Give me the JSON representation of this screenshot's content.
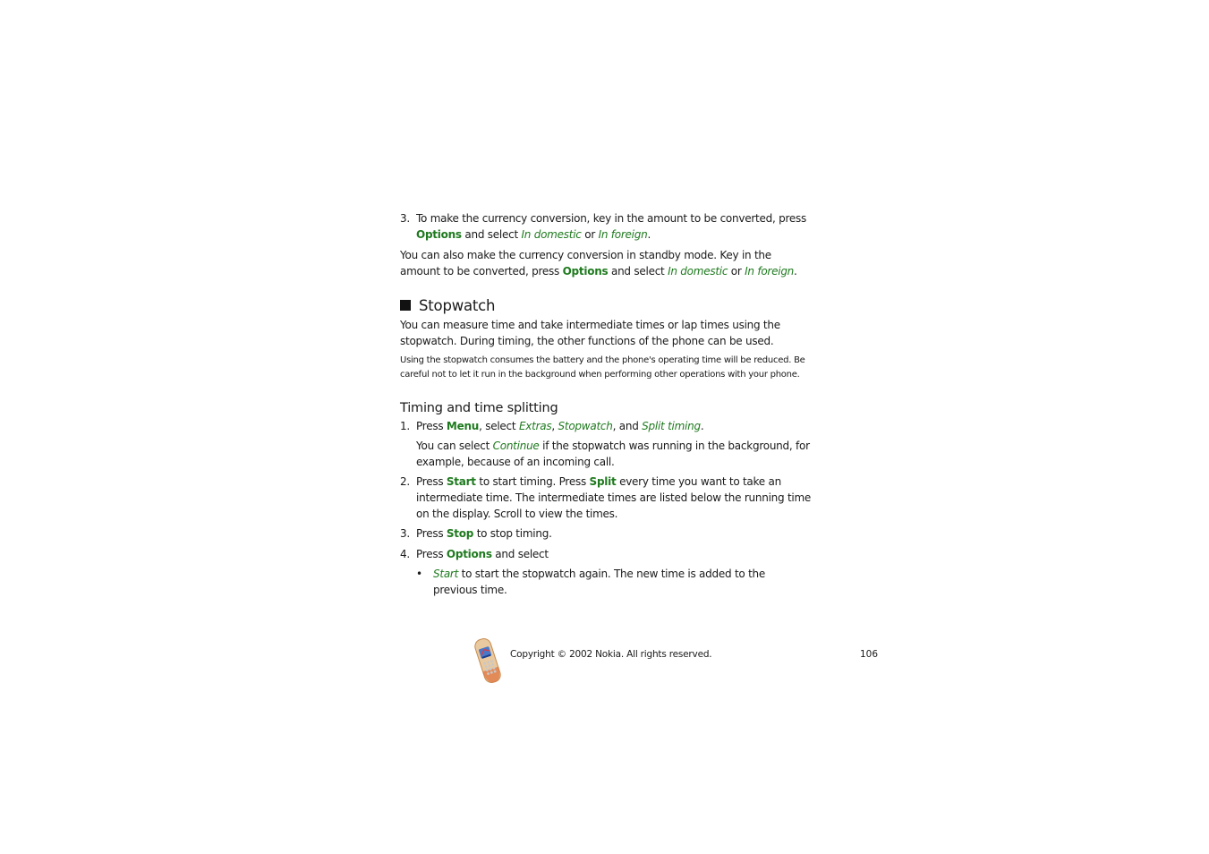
{
  "intro": {
    "step3": {
      "number": "3.",
      "t1": "To make the currency conversion, key in the amount to be converted, press ",
      "k1": "Options",
      "t2": " and select ",
      "o1": "In domestic",
      "t3": " or ",
      "o2": "In foreign",
      "t4": "."
    },
    "para": {
      "t1": "You can also make the currency conversion in standby mode. Key in the amount to be converted, press ",
      "k1": "Options",
      "t2": " and select ",
      "o1": "In domestic",
      "t3": " or ",
      "o2": "In foreign",
      "t4": "."
    }
  },
  "section": {
    "title": "Stopwatch",
    "para1": "You can measure time and take intermediate times or lap times using the stopwatch. During timing, the other functions of the phone can be used.",
    "note": "Using the stopwatch consumes the battery and the phone's operating time will be reduced. Be careful not to let it run in the background when performing other operations with your phone."
  },
  "subsection": {
    "title": "Timing and time splitting",
    "step1": {
      "number": "1.",
      "t1": "Press ",
      "k1": "Menu",
      "t2": ", select ",
      "o1": "Extras",
      "t3": ", ",
      "o2": "Stopwatch",
      "t4": ", and ",
      "o3": "Split timing",
      "t5": ".",
      "sub_t1": "You can select ",
      "sub_o1": "Continue",
      "sub_t2": " if the stopwatch was running in the background, for example, because of an incoming call."
    },
    "step2": {
      "number": "2.",
      "t1": "Press ",
      "k1": "Start",
      "t2": " to start timing. Press ",
      "k2": "Split",
      "t3": " every time you want to take an intermediate time. The intermediate times are listed below the running time on the display. Scroll to view the times."
    },
    "step3": {
      "number": "3.",
      "t1": "Press ",
      "k1": "Stop",
      "t2": " to stop timing."
    },
    "step4": {
      "number": "4.",
      "t1": "Press ",
      "k1": "Options",
      "t2": " and select",
      "bullet": "•",
      "b_o1": "Start",
      "b_t1": " to start the stopwatch again. The new time is added to the previous time."
    }
  },
  "footer": {
    "icon": "nokia-phone-icon",
    "copyright": "Copyright © 2002 Nokia. All rights reserved.",
    "page_number": "106"
  },
  "colors": {
    "keyword_green": "#1f7a1f",
    "text": "#1a1a1a"
  }
}
